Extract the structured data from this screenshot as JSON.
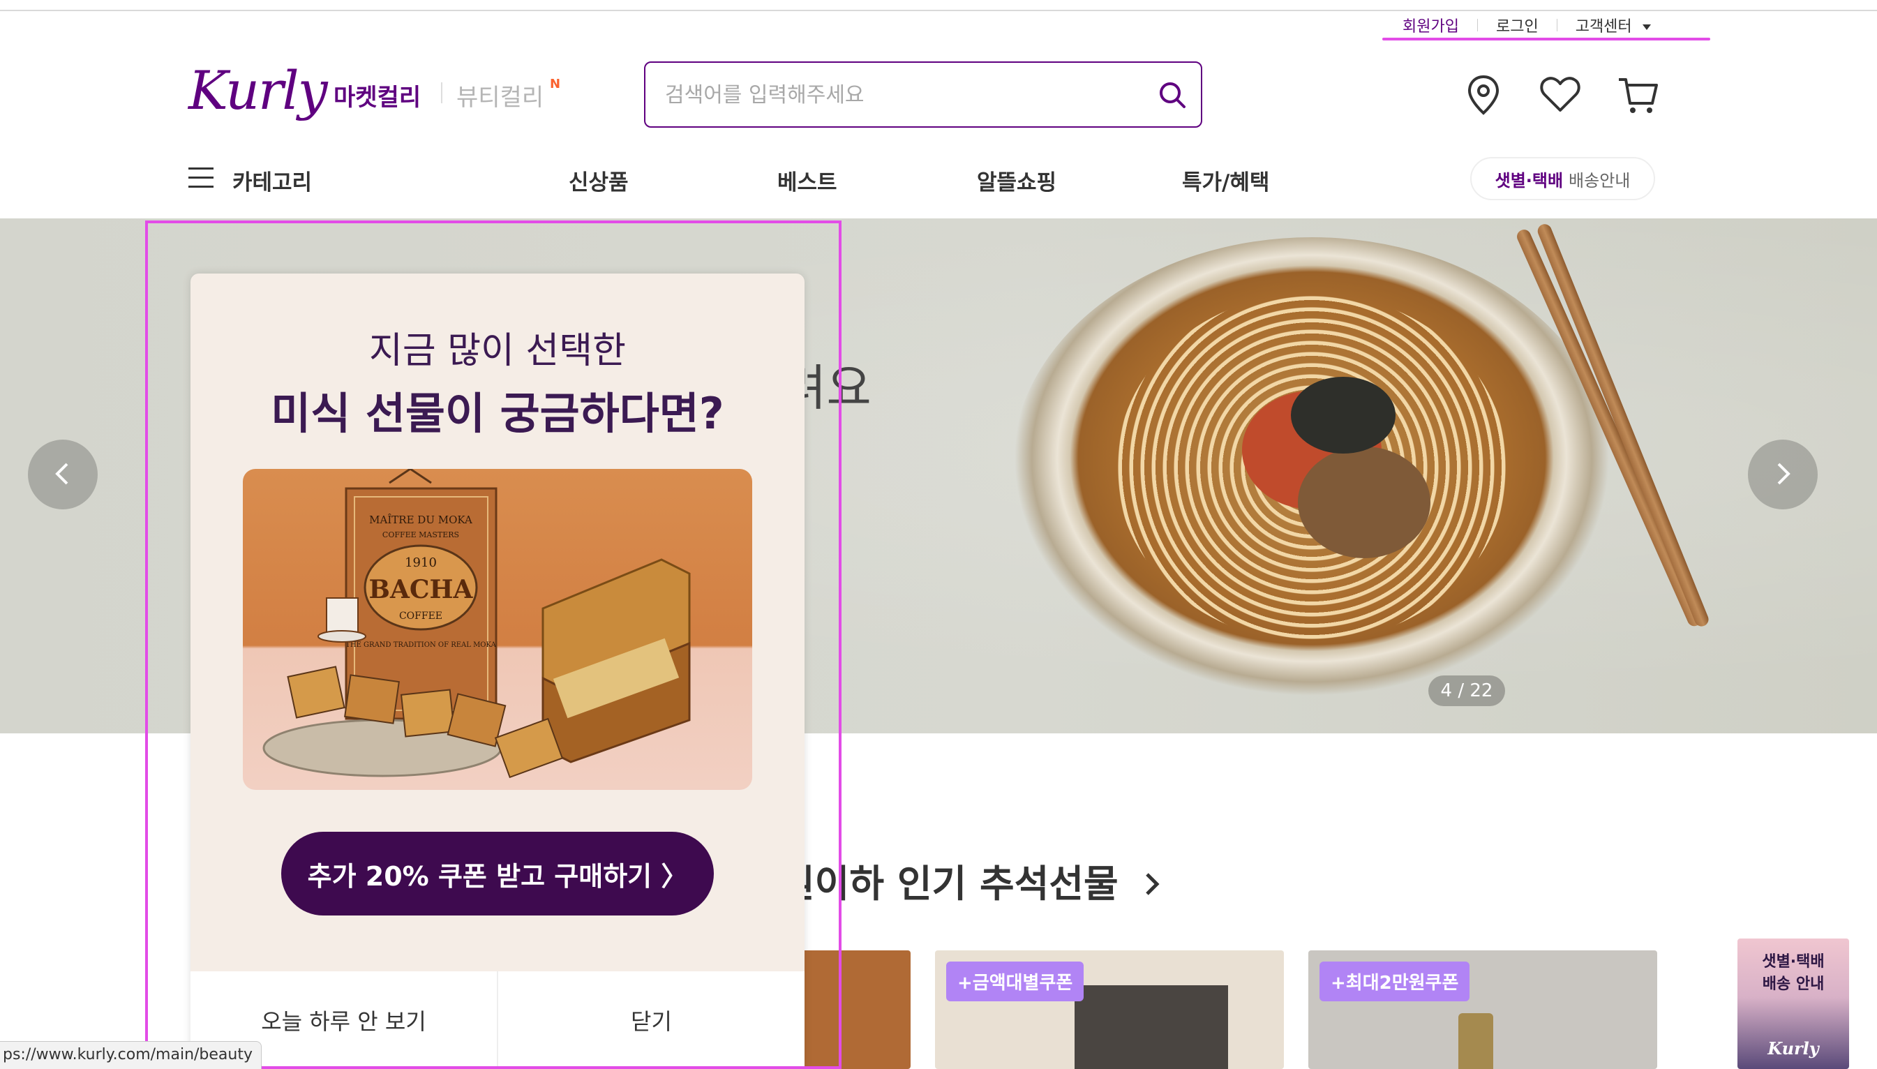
{
  "util": {
    "signup": "회원가입",
    "login": "로그인",
    "support": "고객센터"
  },
  "header": {
    "logo": "Kurly",
    "market": "마켓컬리",
    "beauty": "뷰티컬리",
    "beauty_badge": "N",
    "search_placeholder": "검색어를 입력해주세요"
  },
  "icons": [
    "location-icon",
    "heart-icon",
    "cart-icon",
    "search-icon",
    "hamburger-icon",
    "chevron-left-icon",
    "chevron-right-icon",
    "chevron-down-icon"
  ],
  "nav": {
    "category": "카테고리",
    "items": [
      "신상품",
      "베스트",
      "알뜰쇼핑",
      "특가/혜택"
    ],
    "shipping_bold": "샛별·택배",
    "shipping_rest": "배송안내"
  },
  "banner": {
    "partial_text": "려요",
    "counter": "4 / 22"
  },
  "section": {
    "title_partial": "원이하 인기 추석선물"
  },
  "cards": [
    {
      "badge": ""
    },
    {
      "badge": "+금액대별쿠폰"
    },
    {
      "badge": "+최대2만원쿠폰"
    }
  ],
  "side_promo": {
    "line1": "샛별·택배",
    "line2": "배송 안내",
    "logo": "Kurly"
  },
  "popup": {
    "subtitle": "지금 많이 선택한",
    "title": "미식 선물이 궁금하다면?",
    "image_text": {
      "brand_top": "MAÎTRE DU MOKA",
      "brand_sub": "COFFEE MASTERS",
      "year": "1910",
      "brand": "BACHA",
      "coffee": "COFFEE",
      "tagline": "THE GRAND TRADITION OF REAL MOKA"
    },
    "cta": "추가 20% 쿠폰 받고 구매하기 〉",
    "dismiss_today": "오늘 하루 안 보기",
    "close": "닫기"
  },
  "status_url": "ps://www.kurly.com/main/beauty",
  "colors": {
    "brand": "#5f0080",
    "popup_bg": "#f5ede6",
    "cta": "#3e0a4f",
    "badge": "#b184f5",
    "highlight": "#e24ce7"
  }
}
